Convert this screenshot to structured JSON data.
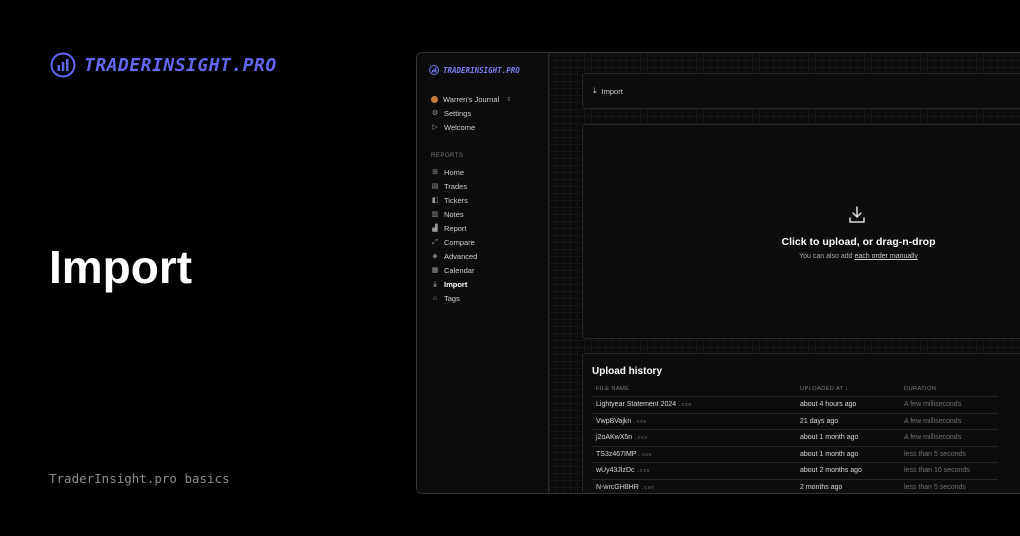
{
  "hero": {
    "brand": "TRADERINSIGHT.PRO",
    "title": "Import",
    "subtitle": "TraderInsight.pro basics"
  },
  "app": {
    "brand": "TRADERINSIGHT.PRO",
    "accent_color": "#6366f1",
    "sidebar": {
      "top_items": [
        {
          "label": "Warren's Journal",
          "icon": "avatar-icon"
        },
        {
          "label": "Settings",
          "icon": "gear-icon"
        },
        {
          "label": "Welcome",
          "icon": "play-icon"
        }
      ],
      "section_label": "REPORTS",
      "report_items": [
        {
          "label": "Home",
          "icon": "grid-icon"
        },
        {
          "label": "Trades",
          "icon": "document-icon"
        },
        {
          "label": "Tickers",
          "icon": "tag-icon"
        },
        {
          "label": "Notes",
          "icon": "note-icon"
        },
        {
          "label": "Report",
          "icon": "bar-chart-icon"
        },
        {
          "label": "Compare",
          "icon": "compare-icon"
        },
        {
          "label": "Advanced",
          "icon": "advanced-icon"
        },
        {
          "label": "Calendar",
          "icon": "calendar-icon"
        },
        {
          "label": "Import",
          "icon": "download-icon",
          "active": true
        },
        {
          "label": "Tags",
          "icon": "tags-icon"
        }
      ]
    },
    "header": {
      "label": "Import"
    },
    "dropzone": {
      "title": "Click to upload, or drag-n-drop",
      "subtitle_prefix": "You can also add ",
      "subtitle_link": "each order manually"
    },
    "history": {
      "title": "Upload history",
      "columns": [
        "FILE NAME",
        "UPLOADED AT ↓",
        "DURATION"
      ],
      "rows": [
        {
          "name": "Lightyear Statement 2024",
          "ext": ".csv",
          "uploaded": "about 4 hours ago",
          "duration": "A few milliseconds"
        },
        {
          "name": "VwpBVajkn",
          "ext": ".csv",
          "uploaded": "21 days ago",
          "duration": "A few milliseconds"
        },
        {
          "name": "j2oAKwX5n",
          "ext": ".csv",
          "uploaded": "about 1 month ago",
          "duration": "A few milliseconds"
        },
        {
          "name": "TS3z467IMP",
          "ext": ".csv",
          "uploaded": "about 1 month ago",
          "duration": "less than 5 seconds"
        },
        {
          "name": "wUy43JlzDc",
          "ext": ".csv",
          "uploaded": "about 2 months ago",
          "duration": "less than 10 seconds"
        },
        {
          "name": "N-wrcGH8HR",
          "ext": ".csv",
          "uploaded": "2 months ago",
          "duration": "less than 5 seconds"
        }
      ]
    }
  }
}
